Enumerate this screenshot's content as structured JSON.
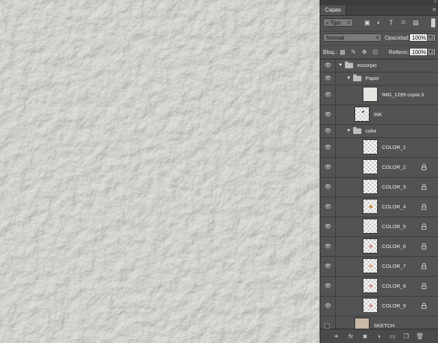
{
  "panel": {
    "tab_label": "Capas",
    "collapse_glyph": "«",
    "filter": {
      "kind_label": "Tipo"
    },
    "blend_mode": "Normal",
    "opacity_label": "Opacidad:",
    "opacity_value": "100%",
    "lock_label": "Bloq.:",
    "fill_label": "Relleno:",
    "fill_value": "100%"
  },
  "layers": [
    {
      "name": "escorpio",
      "type": "group",
      "indent": 0,
      "expanded": true,
      "visible": true,
      "locked": false
    },
    {
      "name": "Paper",
      "type": "group",
      "indent": 1,
      "expanded": true,
      "visible": true,
      "locked": false
    },
    {
      "name": "IMG_1299 copia 3",
      "type": "layer",
      "indent": 2,
      "visible": true,
      "locked": false,
      "thumb": "paper"
    },
    {
      "name": "INK",
      "type": "layer",
      "indent": 1,
      "visible": true,
      "locked": false,
      "thumb": "ink"
    },
    {
      "name": "color",
      "type": "group",
      "indent": 1,
      "expanded": true,
      "visible": true,
      "locked": false
    },
    {
      "name": "COLOR_1",
      "type": "layer",
      "indent": 2,
      "visible": true,
      "locked": false,
      "thumb": "blank"
    },
    {
      "name": "COLOR_2",
      "type": "layer",
      "indent": 2,
      "visible": true,
      "locked": true,
      "thumb": "blank"
    },
    {
      "name": "COLOR_3",
      "type": "layer",
      "indent": 2,
      "visible": true,
      "locked": true,
      "thumb": "blank"
    },
    {
      "name": "COLOR_4",
      "type": "layer",
      "indent": 2,
      "visible": true,
      "locked": true,
      "thumb": "orange"
    },
    {
      "name": "COLOR_5",
      "type": "layer",
      "indent": 2,
      "visible": true,
      "locked": true,
      "thumb": "blank"
    },
    {
      "name": "COLOR_6",
      "type": "layer",
      "indent": 2,
      "visible": true,
      "locked": true,
      "thumb": "pink"
    },
    {
      "name": "COLOR_7",
      "type": "layer",
      "indent": 2,
      "visible": true,
      "locked": true,
      "thumb": "peach"
    },
    {
      "name": "COLOR_8",
      "type": "layer",
      "indent": 2,
      "visible": true,
      "locked": true,
      "thumb": "pink"
    },
    {
      "name": "COLOR_9",
      "type": "layer",
      "indent": 2,
      "visible": true,
      "locked": true,
      "thumb": "pink"
    },
    {
      "name": "SKETCH",
      "type": "layer",
      "indent": 1,
      "visible": false,
      "locked": false,
      "thumb": "sketch"
    }
  ],
  "colors": {
    "panel_bg": "#535353",
    "canvas_bg": "#e4e6e2",
    "thumb_orange": "#d9892f",
    "thumb_pink": "#e08a8a",
    "thumb_peach": "#e6a77a"
  }
}
